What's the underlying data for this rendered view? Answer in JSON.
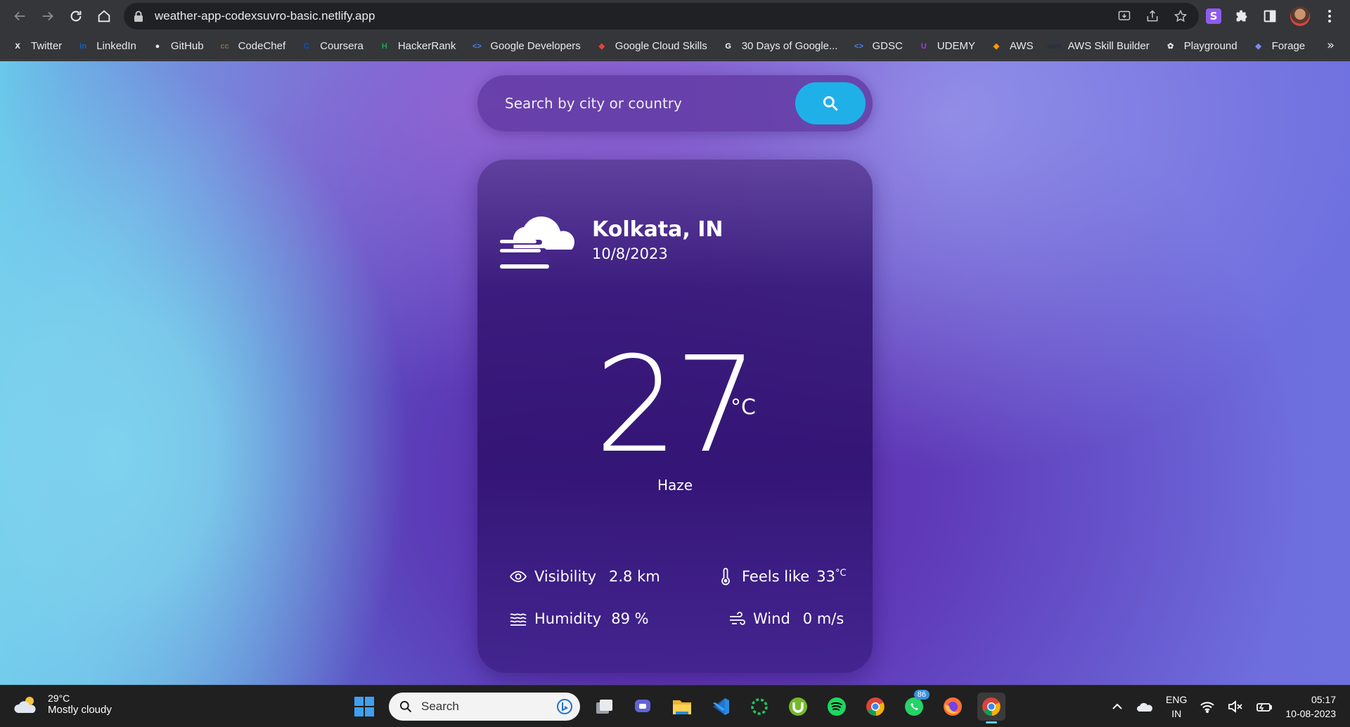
{
  "browser": {
    "url": "weather-app-codexsuvro-basic.netlify.app",
    "extension_badge": "S"
  },
  "bookmarks": [
    {
      "label": "Twitter",
      "icon": "x-logo-icon",
      "color": "#ffffff"
    },
    {
      "label": "LinkedIn",
      "icon": "linkedin-icon",
      "color": "#0a66c2"
    },
    {
      "label": "GitHub",
      "icon": "github-icon",
      "color": "#e8eaed"
    },
    {
      "label": "CodeChef",
      "icon": "codechef-icon",
      "color": "#8a6a4a"
    },
    {
      "label": "Coursera",
      "icon": "coursera-icon",
      "color": "#0056d2"
    },
    {
      "label": "HackerRank",
      "icon": "hackerrank-icon",
      "color": "#1ba94c"
    },
    {
      "label": "Google Developers",
      "icon": "google-developers-icon",
      "color": "#4285f4"
    },
    {
      "label": "Google Cloud Skills",
      "icon": "google-cloud-icon",
      "color": "#ea4335"
    },
    {
      "label": "30 Days of Google...",
      "icon": "google-icon",
      "color": "#ffffff"
    },
    {
      "label": "GDSC",
      "icon": "gdsc-icon",
      "color": "#4285f4"
    },
    {
      "label": "UDEMY",
      "icon": "udemy-icon",
      "color": "#a435f0"
    },
    {
      "label": "AWS",
      "icon": "aws-icon",
      "color": "#ff9900"
    },
    {
      "label": "AWS Skill Builder",
      "icon": "aws-skill-builder-icon",
      "color": "#232f3e"
    },
    {
      "label": "Playground",
      "icon": "openai-icon",
      "color": "#e8eaed"
    },
    {
      "label": "Forage",
      "icon": "forage-icon",
      "color": "#7b8cf0"
    }
  ],
  "bookmarks_more": "»",
  "search": {
    "placeholder": "Search by city or country"
  },
  "weather": {
    "city": "Kolkata, IN",
    "date": "10/8/2023",
    "temperature": "27",
    "unit": "°C",
    "condition": "Haze",
    "icon": "haze-cloud-icon",
    "stats": {
      "visibility": {
        "label": "Visibility",
        "value": "2.8 km"
      },
      "feels_like": {
        "label": "Feels like",
        "value": "33",
        "unit": "°C"
      },
      "humidity": {
        "label": "Humidity",
        "value": "89 %"
      },
      "wind": {
        "label": "Wind",
        "value": "0 m/s"
      }
    }
  },
  "taskbar": {
    "weather_temp": "29°C",
    "weather_desc": "Mostly cloudy",
    "search_label": "Search",
    "whatsapp_badge": "86",
    "lang_line1": "ENG",
    "lang_line2": "IN",
    "time": "05:17",
    "date": "10-08-2023"
  },
  "colors": {
    "accent_button": "#20b0e8",
    "card_bg": "#3a1b7a"
  }
}
